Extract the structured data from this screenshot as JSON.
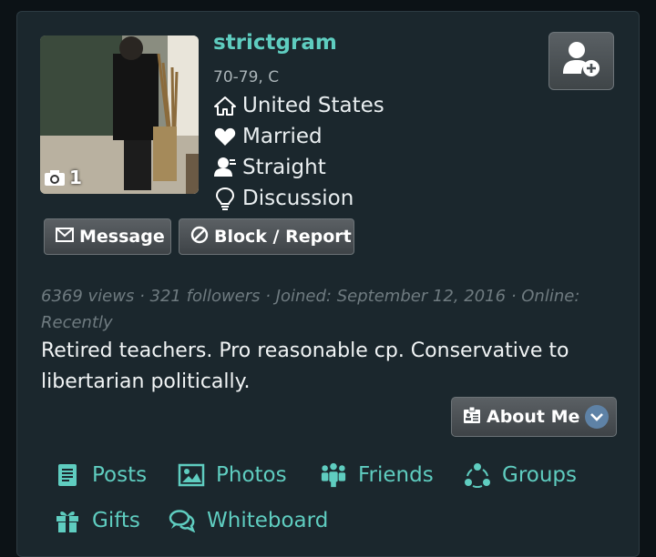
{
  "profile": {
    "username": "strictgram",
    "age_gender": "70-79, C",
    "photo_count": "1",
    "location": "United States",
    "relationship": "Married",
    "orientation": "Straight",
    "interest": "Discussion"
  },
  "buttons": {
    "message": "Message",
    "block_report": "Block / Report",
    "about_me": "About Me"
  },
  "stats_line": "6369 views · 321 followers · Joined: September 12, 2016 · Online: Recently",
  "bio": "Retired teachers. Pro reasonable cp. Conservative to libertarian politically.",
  "nav": {
    "posts": "Posts",
    "photos": "Photos",
    "friends": "Friends",
    "groups": "Groups",
    "gifts": "Gifts",
    "whiteboard": "Whiteboard"
  },
  "colors": {
    "accent": "#5fcdc0",
    "card_bg": "#1b272d",
    "page_bg": "#0c1216"
  },
  "icons": [
    "camera-icon",
    "home-icon",
    "heart-icon",
    "user-icon",
    "lightbulb-icon",
    "add-friend-icon",
    "envelope-icon",
    "block-icon",
    "id-card-icon",
    "chevron-down-icon",
    "document-icon",
    "image-icon",
    "people-icon",
    "network-icon",
    "gift-icon",
    "chat-icon"
  ]
}
